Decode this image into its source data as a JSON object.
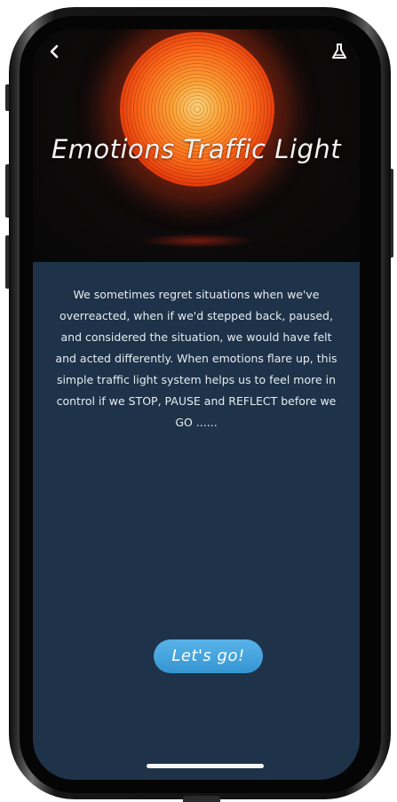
{
  "header": {
    "back_icon": "chevron-left-icon",
    "action_icon": "flask-icon",
    "title": "Emotions Traffic Light"
  },
  "hero": {
    "image": "red-traffic-light-photo"
  },
  "main": {
    "description": "We sometimes regret situations when we've overreacted, when if we'd stepped back, paused, and considered the situation, we would have felt and acted differently. When emotions flare up, this simple traffic light system helps us to feel more in control if we STOP, PAUSE and REFLECT before we GO ......"
  },
  "cta": {
    "label": "Let's go!"
  },
  "colors": {
    "background": "#1e3349",
    "accent": "#3ea3dd",
    "text": "#e6ecf2"
  }
}
